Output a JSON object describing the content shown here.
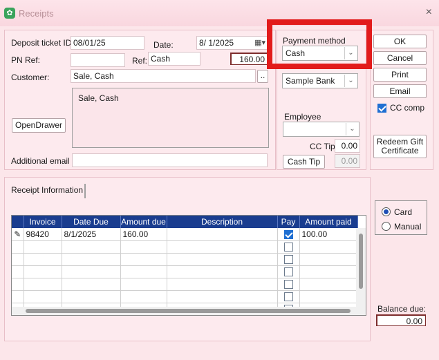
{
  "window": {
    "title": "Receipts",
    "close": "×"
  },
  "header": {
    "deposit_ticket_label": "Deposit ticket ID",
    "deposit_ticket_value": "08/01/25",
    "date_label": "Date:",
    "date_value": "8/  1/2025",
    "pn_ref_label": "PN Ref:",
    "pn_ref_value": "",
    "ref_label": "Ref:",
    "ref_value": "Cash",
    "amount_total": "160.00",
    "customer_label": "Customer:",
    "customer_value": "Sale, Cash",
    "customer_lookup": "..",
    "address_text": "Sale, Cash",
    "open_drawer_label": "OpenDrawer",
    "additional_email_label": "Additional email",
    "additional_email_value": ""
  },
  "payment": {
    "method_label": "Payment method",
    "method_value": "Cash",
    "bank_value": "Sample Bank",
    "employee_label": "Employee",
    "employee_value": "",
    "cc_tip_label": "CC Tip",
    "cc_tip_value": "0.00",
    "cash_tip_label": "Cash Tip",
    "cash_tip_value": "0.00"
  },
  "actions": {
    "ok": "OK",
    "cancel": "Cancel",
    "print": "Print",
    "email": "Email",
    "cc_comp_label": "CC comp",
    "cc_comp_checked": true,
    "redeem_gift_certificate": "Redeem Gift Certificate"
  },
  "receipt_info": {
    "tab_label": "Receipt Information",
    "columns": [
      "Invoice",
      "Date Due",
      "Amount due",
      "Description",
      "Pay",
      "Amount paid"
    ],
    "rows": [
      {
        "invoice": "98420",
        "date_due": "8/1/2025",
        "amount_due": "160.00",
        "description": "",
        "pay": true,
        "amount_paid": "100.00"
      },
      {
        "invoice": "",
        "date_due": "",
        "amount_due": "",
        "description": "",
        "pay": false,
        "amount_paid": ""
      },
      {
        "invoice": "",
        "date_due": "",
        "amount_due": "",
        "description": "",
        "pay": false,
        "amount_paid": ""
      },
      {
        "invoice": "",
        "date_due": "",
        "amount_due": "",
        "description": "",
        "pay": false,
        "amount_paid": ""
      },
      {
        "invoice": "",
        "date_due": "",
        "amount_due": "",
        "description": "",
        "pay": false,
        "amount_paid": ""
      },
      {
        "invoice": "",
        "date_due": "",
        "amount_due": "",
        "description": "",
        "pay": false,
        "amount_paid": ""
      },
      {
        "invoice": "",
        "date_due": "",
        "amount_due": "",
        "description": "",
        "pay": false,
        "amount_paid": ""
      }
    ]
  },
  "payment_type": {
    "card_label": "Card",
    "manual_label": "Manual",
    "selected": "Card"
  },
  "balance": {
    "label": "Balance due:",
    "value": "0.00"
  },
  "colors": {
    "highlight": "#e21b1b",
    "grid_header": "#1a3d8f",
    "background": "#fce6ea"
  }
}
